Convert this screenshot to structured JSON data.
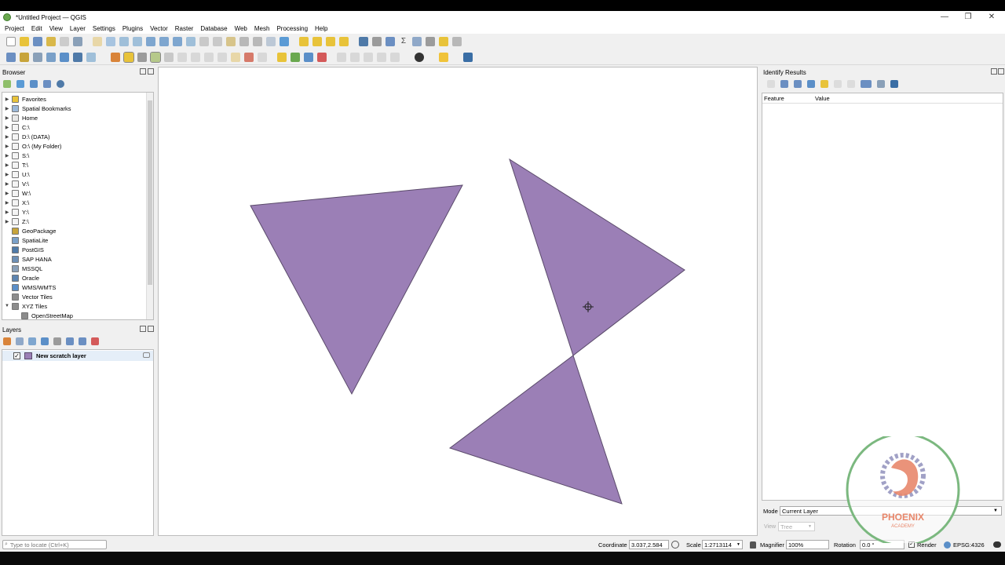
{
  "window": {
    "title": "*Untitled Project — QGIS",
    "minimize_glyph": "—",
    "maximize_glyph": "❐",
    "close_glyph": "✕"
  },
  "menu": [
    "Project",
    "Edit",
    "View",
    "Layer",
    "Settings",
    "Plugins",
    "Vector",
    "Raster",
    "Database",
    "Web",
    "Mesh",
    "Processing",
    "Help"
  ],
  "browser": {
    "title": "Browser",
    "items": [
      {
        "label": "Favorites",
        "icon": "star-icon",
        "color": "#e8c33a",
        "expand": true
      },
      {
        "label": "Spatial Bookmarks",
        "icon": "bookmark-icon",
        "color": "#9bb8d8",
        "expand": true
      },
      {
        "label": "Home",
        "icon": "home-folder-icon",
        "color": "#e8e8e8",
        "expand": true
      },
      {
        "label": "C:\\",
        "icon": "drive-icon",
        "color": "#f4f4f4",
        "expand": true
      },
      {
        "label": "D:\\ (DATA)",
        "icon": "drive-icon",
        "color": "#f4f4f4",
        "expand": true
      },
      {
        "label": "O:\\ (My Folder)",
        "icon": "drive-icon",
        "color": "#f4f4f4",
        "expand": true
      },
      {
        "label": "S:\\",
        "icon": "drive-icon",
        "color": "#f4f4f4",
        "expand": true
      },
      {
        "label": "T:\\",
        "icon": "drive-icon",
        "color": "#f4f4f4",
        "expand": true
      },
      {
        "label": "U:\\",
        "icon": "drive-icon",
        "color": "#f4f4f4",
        "expand": true
      },
      {
        "label": "V:\\",
        "icon": "drive-icon",
        "color": "#f4f4f4",
        "expand": true
      },
      {
        "label": "W:\\",
        "icon": "drive-icon",
        "color": "#f4f4f4",
        "expand": true
      },
      {
        "label": "X:\\",
        "icon": "drive-icon",
        "color": "#f4f4f4",
        "expand": true
      },
      {
        "label": "Y:\\",
        "icon": "drive-icon",
        "color": "#f4f4f4",
        "expand": true
      },
      {
        "label": "Z:\\",
        "icon": "drive-icon",
        "color": "#f4f4f4",
        "expand": true
      },
      {
        "label": "GeoPackage",
        "icon": "geopackage-icon",
        "color": "#c7a43b",
        "expand": false
      },
      {
        "label": "SpatiaLite",
        "icon": "spatialite-icon",
        "color": "#7aa0c8",
        "expand": false
      },
      {
        "label": "PostGIS",
        "icon": "postgis-icon",
        "color": "#4f7aa8",
        "expand": false
      },
      {
        "label": "SAP HANA",
        "icon": "sap-hana-icon",
        "color": "#6c8fb5",
        "expand": false
      },
      {
        "label": "MSSQL",
        "icon": "mssql-icon",
        "color": "#8aa0b8",
        "expand": false
      },
      {
        "label": "Oracle",
        "icon": "oracle-icon",
        "color": "#5c84b0",
        "expand": false
      },
      {
        "label": "WMS/WMTS",
        "icon": "globe-icon",
        "color": "#5b8fc8",
        "expand": false
      },
      {
        "label": "Vector Tiles",
        "icon": "grid-icon",
        "color": "#8c8c8c",
        "expand": false
      },
      {
        "label": "XYZ Tiles",
        "icon": "grid-icon",
        "color": "#8c8c8c",
        "expand": true,
        "open": true
      },
      {
        "label": "OpenStreetMap",
        "icon": "grid-icon",
        "color": "#8c8c8c",
        "expand": false,
        "child": true
      }
    ]
  },
  "layers": {
    "title": "Layers",
    "items": [
      {
        "label": "New scratch layer",
        "checked": true,
        "color": "#9b7fb6"
      }
    ]
  },
  "identify": {
    "title": "Identify Results",
    "col_feature": "Feature",
    "col_value": "Value",
    "mode_label": "Mode",
    "mode_value": "Current Layer",
    "view_label": "View",
    "view_value": "Tree"
  },
  "map": {
    "fill": "#9b7fb6",
    "stroke": "#5a4a6a"
  },
  "status": {
    "locate_placeholder": "Type to locate (Ctrl+K)",
    "coordinate_label": "Coordinate",
    "coordinate_value": "3.037,2.584",
    "scale_label": "Scale",
    "scale_value": "1:2713114",
    "magnifier_label": "Magnifier",
    "magnifier_value": "100%",
    "rotation_label": "Rotation",
    "rotation_value": "0.0 °",
    "render_label": "Render",
    "render_checked": true,
    "crs": "EPSG:4326"
  },
  "logo": {
    "brand": "PHOENIX",
    "tagline": "ACADEMY",
    "ring_color": "#7bb87f",
    "brand_color": "#e8876b"
  }
}
